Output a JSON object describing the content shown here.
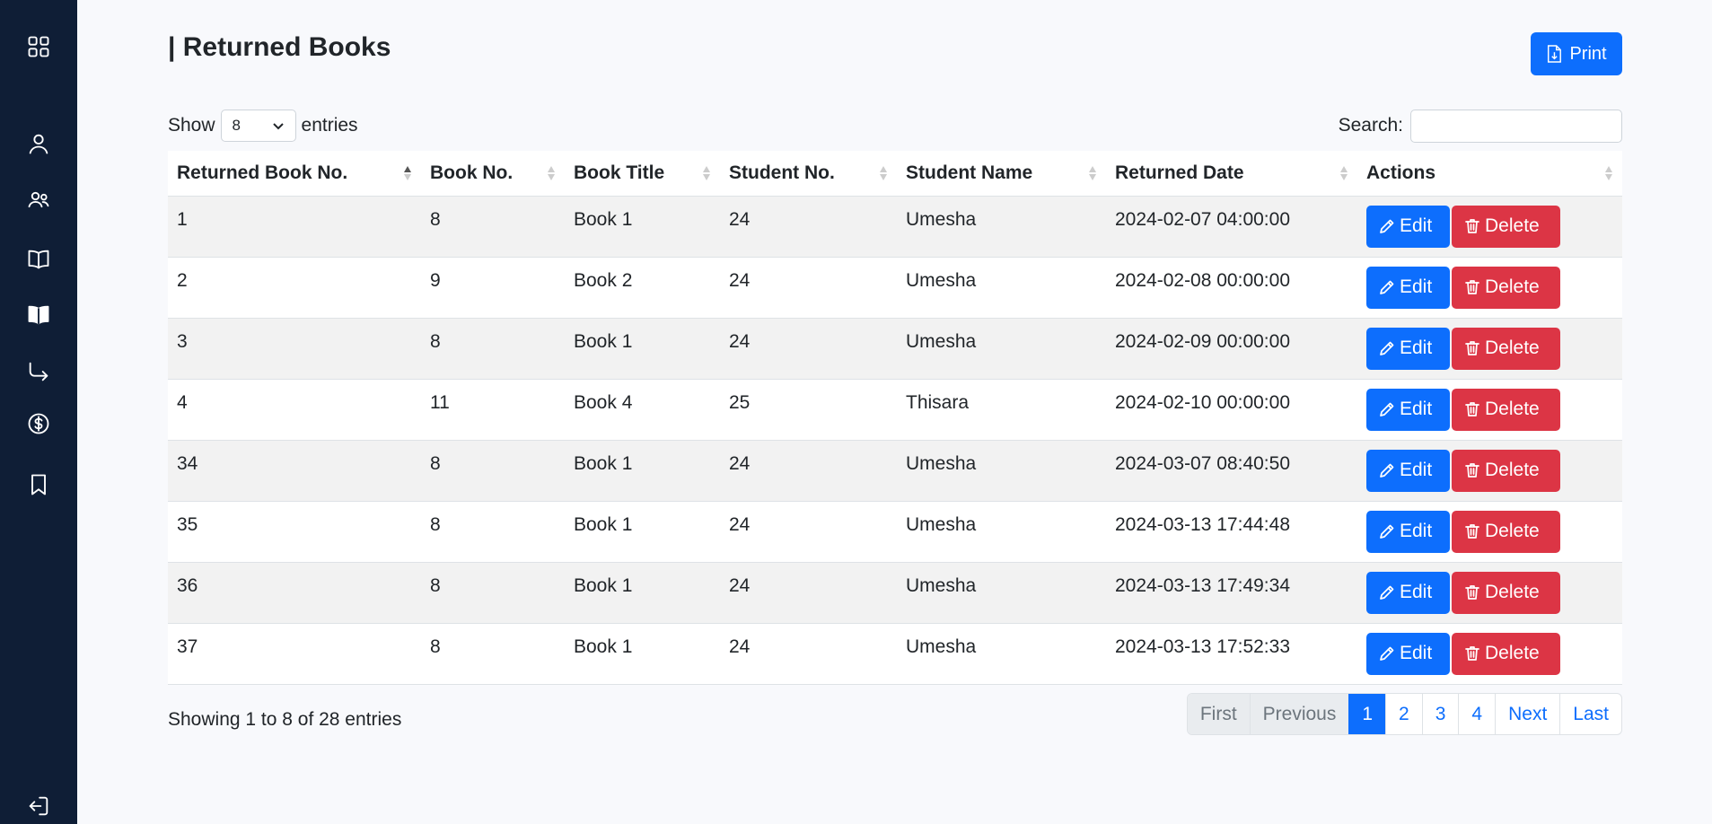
{
  "page": {
    "title": "| Returned Books",
    "print_label": "Print"
  },
  "sidebar": {
    "items": [
      {
        "icon": "dashboard-grid-icon"
      },
      {
        "icon": "user-icon"
      },
      {
        "icon": "users-icon"
      },
      {
        "icon": "book-open-icon"
      },
      {
        "icon": "book-filled-icon"
      },
      {
        "icon": "return-arrow-icon"
      },
      {
        "icon": "dollar-circle-icon"
      },
      {
        "icon": "bookmark-icon"
      },
      {
        "icon": "logout-icon"
      }
    ]
  },
  "controls": {
    "show_label": "Show",
    "entries_value": "8",
    "entries_label": "entries",
    "search_label": "Search:",
    "search_value": ""
  },
  "table": {
    "headers": [
      "Returned Book No.",
      "Book No.",
      "Book Title",
      "Student No.",
      "Student Name",
      "Returned Date",
      "Actions"
    ],
    "edit_label": "Edit",
    "delete_label": "Delete",
    "rows": [
      {
        "returned_no": "1",
        "book_no": "8",
        "title": "Book 1",
        "student_no": "24",
        "student_name": "Umesha",
        "date": "2024-02-07 04:00:00"
      },
      {
        "returned_no": "2",
        "book_no": "9",
        "title": "Book 2",
        "student_no": "24",
        "student_name": "Umesha",
        "date": "2024-02-08 00:00:00"
      },
      {
        "returned_no": "3",
        "book_no": "8",
        "title": "Book 1",
        "student_no": "24",
        "student_name": "Umesha",
        "date": "2024-02-09 00:00:00"
      },
      {
        "returned_no": "4",
        "book_no": "11",
        "title": "Book 4",
        "student_no": "25",
        "student_name": "Thisara",
        "date": "2024-02-10 00:00:00"
      },
      {
        "returned_no": "34",
        "book_no": "8",
        "title": "Book 1",
        "student_no": "24",
        "student_name": "Umesha",
        "date": "2024-03-07 08:40:50"
      },
      {
        "returned_no": "35",
        "book_no": "8",
        "title": "Book 1",
        "student_no": "24",
        "student_name": "Umesha",
        "date": "2024-03-13 17:44:48"
      },
      {
        "returned_no": "36",
        "book_no": "8",
        "title": "Book 1",
        "student_no": "24",
        "student_name": "Umesha",
        "date": "2024-03-13 17:49:34"
      },
      {
        "returned_no": "37",
        "book_no": "8",
        "title": "Book 1",
        "student_no": "24",
        "student_name": "Umesha",
        "date": "2024-03-13 17:52:33"
      }
    ]
  },
  "footer": {
    "info": "Showing 1 to 8 of 28 entries",
    "pagination": {
      "first": "First",
      "previous": "Previous",
      "pages": [
        "1",
        "2",
        "3",
        "4"
      ],
      "active_page": "1",
      "next": "Next",
      "last": "Last"
    }
  },
  "colors": {
    "sidebar_bg": "#0f1e36",
    "primary": "#0d6efd",
    "danger": "#dc3545",
    "page_bg": "#f8f9fc"
  }
}
